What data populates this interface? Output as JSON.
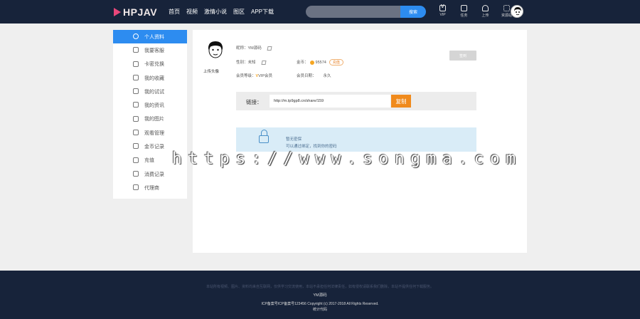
{
  "header": {
    "logo": "HPJAV",
    "nav": [
      "首页",
      "视频",
      "激情小说",
      "图区",
      "APP下载"
    ],
    "search": {
      "placeholder": "",
      "button": "搜索"
    },
    "tools": [
      {
        "icon": "vip-icon",
        "label": "VIP"
      },
      {
        "icon": "upload-icon",
        "label": "任务"
      },
      {
        "icon": "cloud-icon",
        "label": "上传"
      },
      {
        "icon": "grid-icon",
        "label": "资源站"
      }
    ]
  },
  "sidebar": {
    "items": [
      {
        "label": "个人资料",
        "icon": "user-icon",
        "active": true
      },
      {
        "label": "我要客服",
        "icon": "alarm-icon",
        "active": false
      },
      {
        "label": "卡密兑换",
        "icon": "ticket-icon",
        "active": false
      },
      {
        "label": "我的收藏",
        "icon": "star-icon",
        "active": false
      },
      {
        "label": "我的试试",
        "icon": "film-icon",
        "active": false
      },
      {
        "label": "我的资讯",
        "icon": "doc-icon",
        "active": false
      },
      {
        "label": "我的图片",
        "icon": "image-icon",
        "active": false
      },
      {
        "label": "观看管理",
        "icon": "settings-icon",
        "active": false
      },
      {
        "label": "金币记录",
        "icon": "coin-icon",
        "active": false
      },
      {
        "label": "充值",
        "icon": "cart-icon",
        "active": false
      },
      {
        "label": "消费记录",
        "icon": "receipt-icon",
        "active": false
      },
      {
        "label": "代理商",
        "icon": "agent-icon",
        "active": false
      }
    ]
  },
  "profile": {
    "avatar_caption": "上传头像",
    "nickname_label": "昵称：",
    "nickname": "YM源码",
    "gender_label": "性别：",
    "gender": "未知",
    "gold_label": "金币：",
    "gold": "95574",
    "recharge": "充值",
    "member_label": "会员等级：",
    "member_level": "VIP会员",
    "expire_label": "会员日期：",
    "expire": "永久",
    "sign_button": "签到"
  },
  "share": {
    "label": "链接：",
    "url": "http://m.tp9gp8.cn/share/159",
    "copy_button": "复制"
  },
  "lock_notice": {
    "title": "暂无密保",
    "desc": "可以通过绑定，找到你的密码"
  },
  "watermark": "https://www.songma.com",
  "footer": {
    "disclaimer": "本站所有视频、图片、资料均来自互联网，仅供学习交流使用，本站不承担任何法律责任，如有侵权请联系我们删除，本站不提供任何下载服务。",
    "site": "YM源码",
    "copyright": "ICP备案号ICP备案号123456    Copyright (c) 2017-2018 All Rights Reserved.",
    "stats": "统计代码"
  }
}
